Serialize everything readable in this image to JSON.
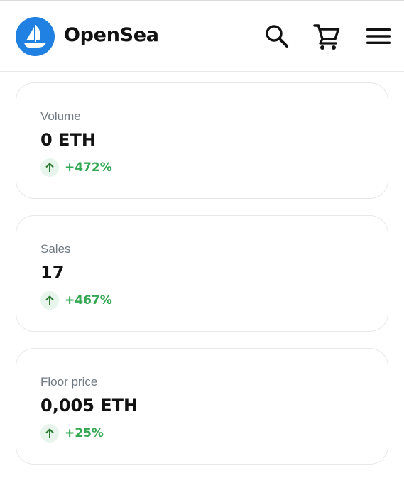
{
  "header": {
    "brand": "OpenSea",
    "icons": [
      "opensea-logo-icon",
      "search-icon",
      "cart-icon",
      "menu-icon"
    ]
  },
  "stats": [
    {
      "label": "Volume",
      "value": "0 ETH",
      "change": "+472%"
    },
    {
      "label": "Sales",
      "value": "17",
      "change": "+467%"
    },
    {
      "label": "Floor price",
      "value": "0,005 ETH",
      "change": "+25%"
    }
  ],
  "colors": {
    "brand_blue": "#2081e2",
    "positive_green": "#34a853",
    "positive_badge_bg": "#e8f5ec",
    "muted_text": "#707a83",
    "border": "#e5e8eb"
  }
}
